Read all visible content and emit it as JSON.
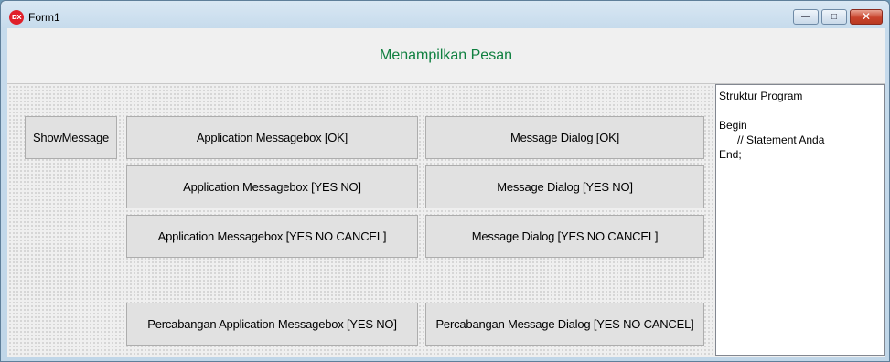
{
  "window": {
    "title": "Form1",
    "icon_label": "DX",
    "controls": {
      "minimize": "—",
      "maximize": "□",
      "close": "✕"
    }
  },
  "header": {
    "title": "Menampilkan Pesan"
  },
  "buttons": {
    "show_message": "ShowMessage",
    "app_ok": "Application Messagebox [OK]",
    "app_yes_no": "Application Messagebox [YES NO]",
    "app_yes_no_cancel": "Application Messagebox [YES NO CANCEL]",
    "dlg_ok": "Message Dialog [OK]",
    "dlg_yes_no": "Message Dialog [YES NO]",
    "dlg_yes_no_cancel": "Message Dialog [YES NO CANCEL]",
    "branch_app_yes_no": "Percabangan Application Messagebox [YES NO]",
    "branch_dlg_yes_no_cancel": "Percabangan Message Dialog [YES NO CANCEL]"
  },
  "memo": {
    "lines": [
      "Struktur Program",
      "",
      "Begin",
      "      // Statement Anda",
      "End;"
    ]
  },
  "colors": {
    "header_text": "#108040",
    "close_button": "#c8432c"
  }
}
